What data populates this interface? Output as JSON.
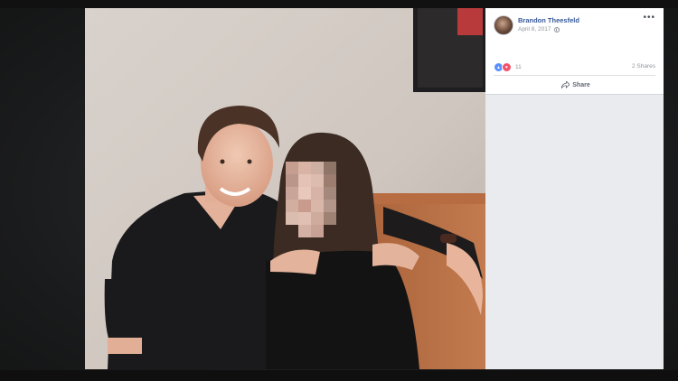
{
  "post": {
    "author": "Brandon Theesfeld",
    "date": "April 8, 2017",
    "privacy_icon": "globe-icon",
    "more_icon": "•••",
    "reaction_count": "11",
    "shares": "2 Shares",
    "share_label": "Share",
    "reaction_icons": [
      "like-icon",
      "love-icon"
    ]
  },
  "colors": {
    "author_link": "#365899",
    "like_blue": "#5890ff",
    "love_red": "#f25268",
    "panel_bg": "#e9ebee"
  }
}
